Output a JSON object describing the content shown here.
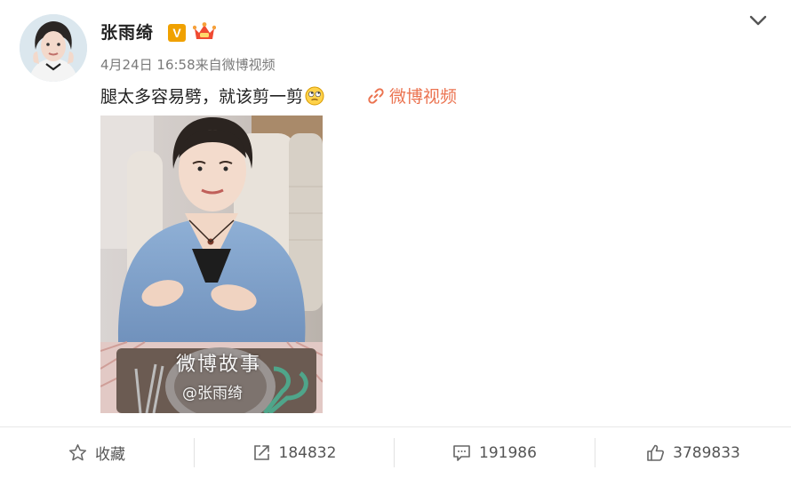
{
  "post": {
    "author": "张雨绮",
    "verified_badge": "V",
    "meta": {
      "date": "4月24日 16:58",
      "source": "来自微博视频"
    },
    "text": "腿太多容易劈，就该剪一剪",
    "video_link": "微博视频",
    "video": {
      "watermark_title": "微博故事",
      "watermark_handle": "@张雨绮"
    }
  },
  "actions": {
    "favorite": "收藏",
    "repost_count": "184832",
    "comment_count": "191986",
    "like_count": "3789833"
  },
  "colors": {
    "link": "#eb7350",
    "badge": "#f0a100",
    "text": "#222222",
    "meta": "#7a7a7a"
  },
  "icons": {
    "favorite": "star-icon",
    "repost": "share-icon",
    "comment": "comment-icon",
    "like": "thumbs-up-icon",
    "menu": "chevron-down-icon",
    "link": "link-icon"
  }
}
